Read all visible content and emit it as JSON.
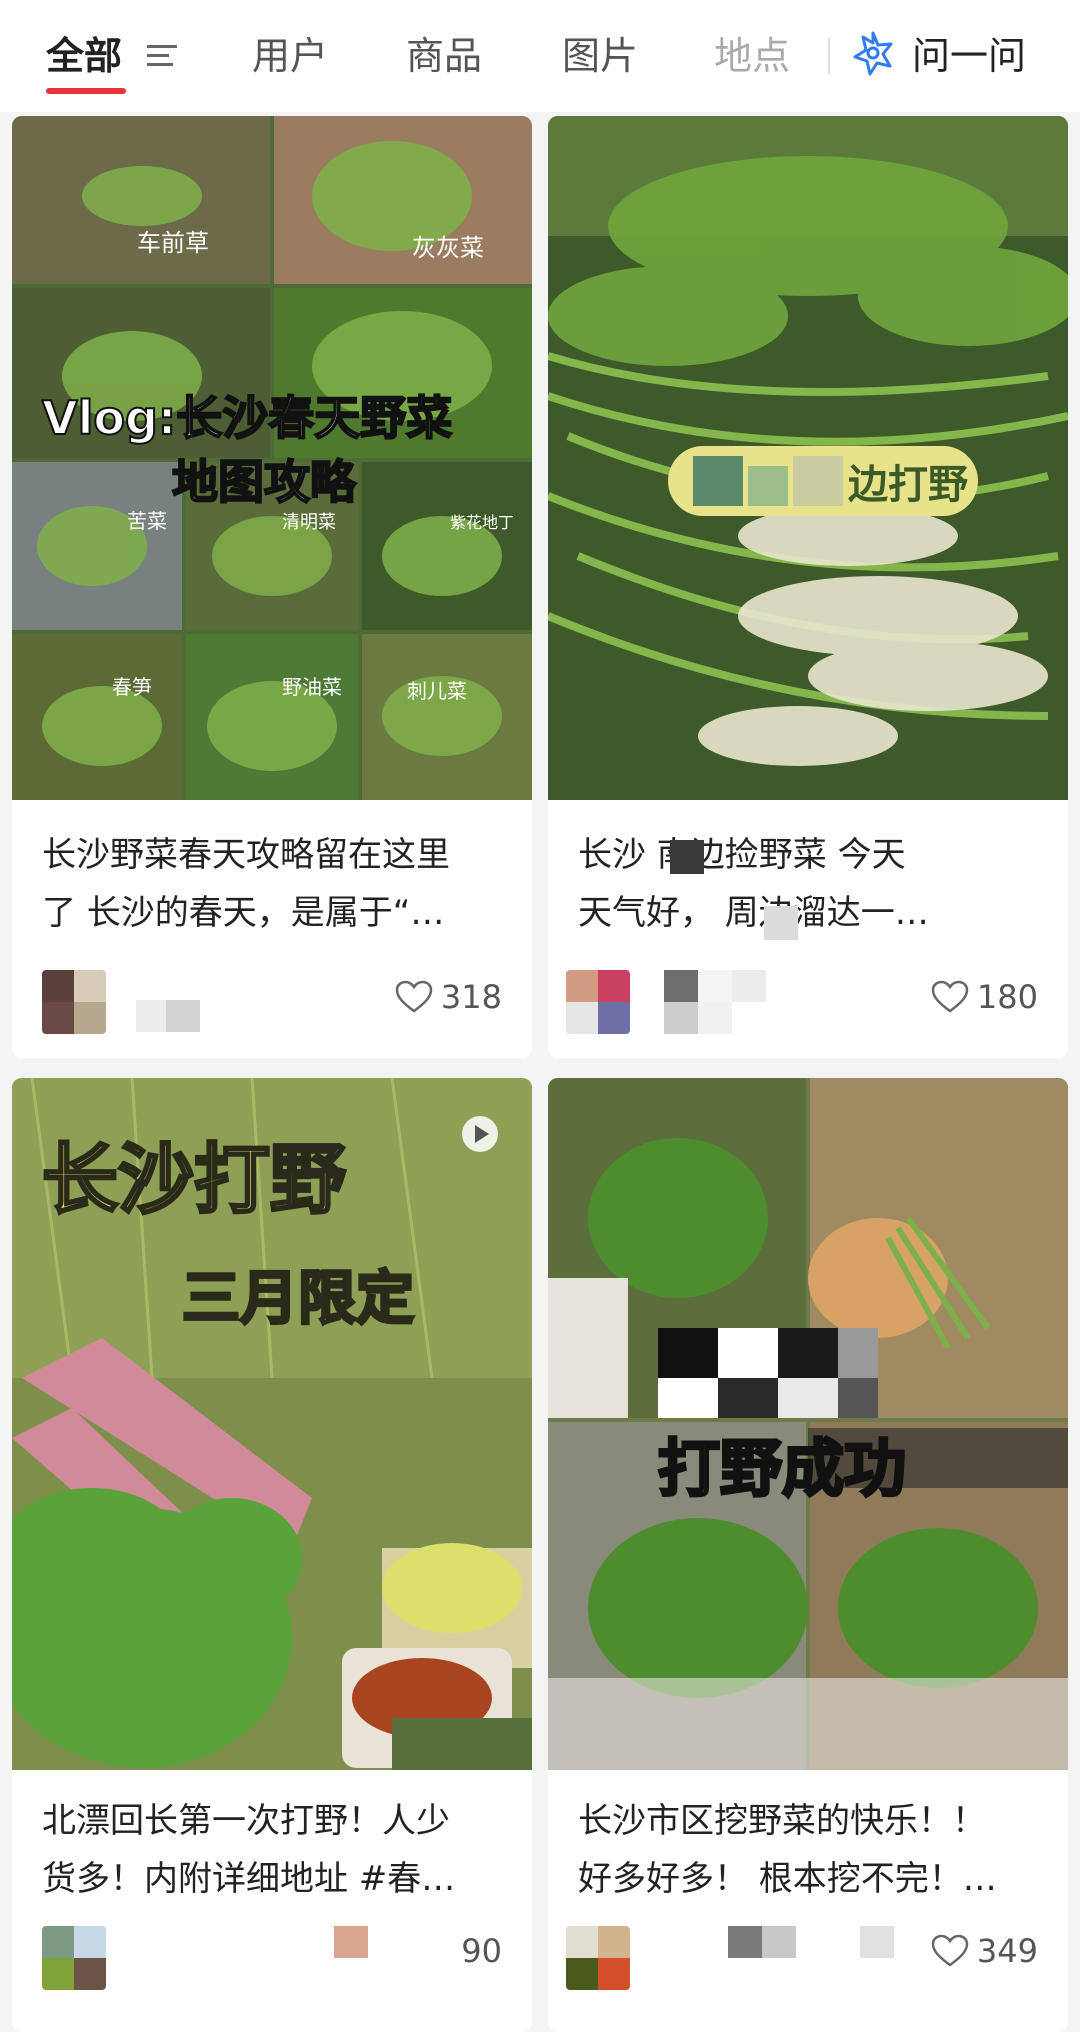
{
  "tabs": {
    "all": "全部",
    "users": "用户",
    "products": "商品",
    "images": "图片",
    "places": "地点",
    "ask": "问一问"
  },
  "cards": [
    {
      "overlay_title_1": "Vlog:长沙春天野菜",
      "overlay_title_2": "地图攻略",
      "plant_labels": [
        "车前草",
        "灰灰菜",
        "苦菜",
        "清明菜",
        "紫花地丁",
        "春笋",
        "野油菜",
        "刺儿菜"
      ],
      "title_line_1": "长沙野菜春天攻略留在这里",
      "title_line_2": "了 长沙的春天，是属于“…",
      "likes": "318"
    },
    {
      "overlay_text": "边打野",
      "title_line_1": "长沙          南边捡野菜 今天",
      "title_line_2": "天气好，       周边溜达一…",
      "likes": "180"
    },
    {
      "overlay_title_1": "长沙打野",
      "overlay_title_2": "三月限定",
      "title_line_1": "北漂回长第一次打野！人少",
      "title_line_2": "货多！内附详细地址 #春…",
      "likes": "90"
    },
    {
      "overlay_text": "打野成功",
      "title_line_1": "长沙市区挖野菜的快乐！！",
      "title_line_2": "好多好多！ 根本挖不完！…",
      "likes": "349"
    }
  ],
  "colors": {
    "accent": "#e8333b",
    "ask_icon": "#2f7cf6",
    "background": "#f4f4f4"
  },
  "icons": {
    "filter": "filter-lines-icon",
    "ask": "ask-star-icon",
    "like": "heart-outline-icon",
    "video": "play-icon"
  }
}
